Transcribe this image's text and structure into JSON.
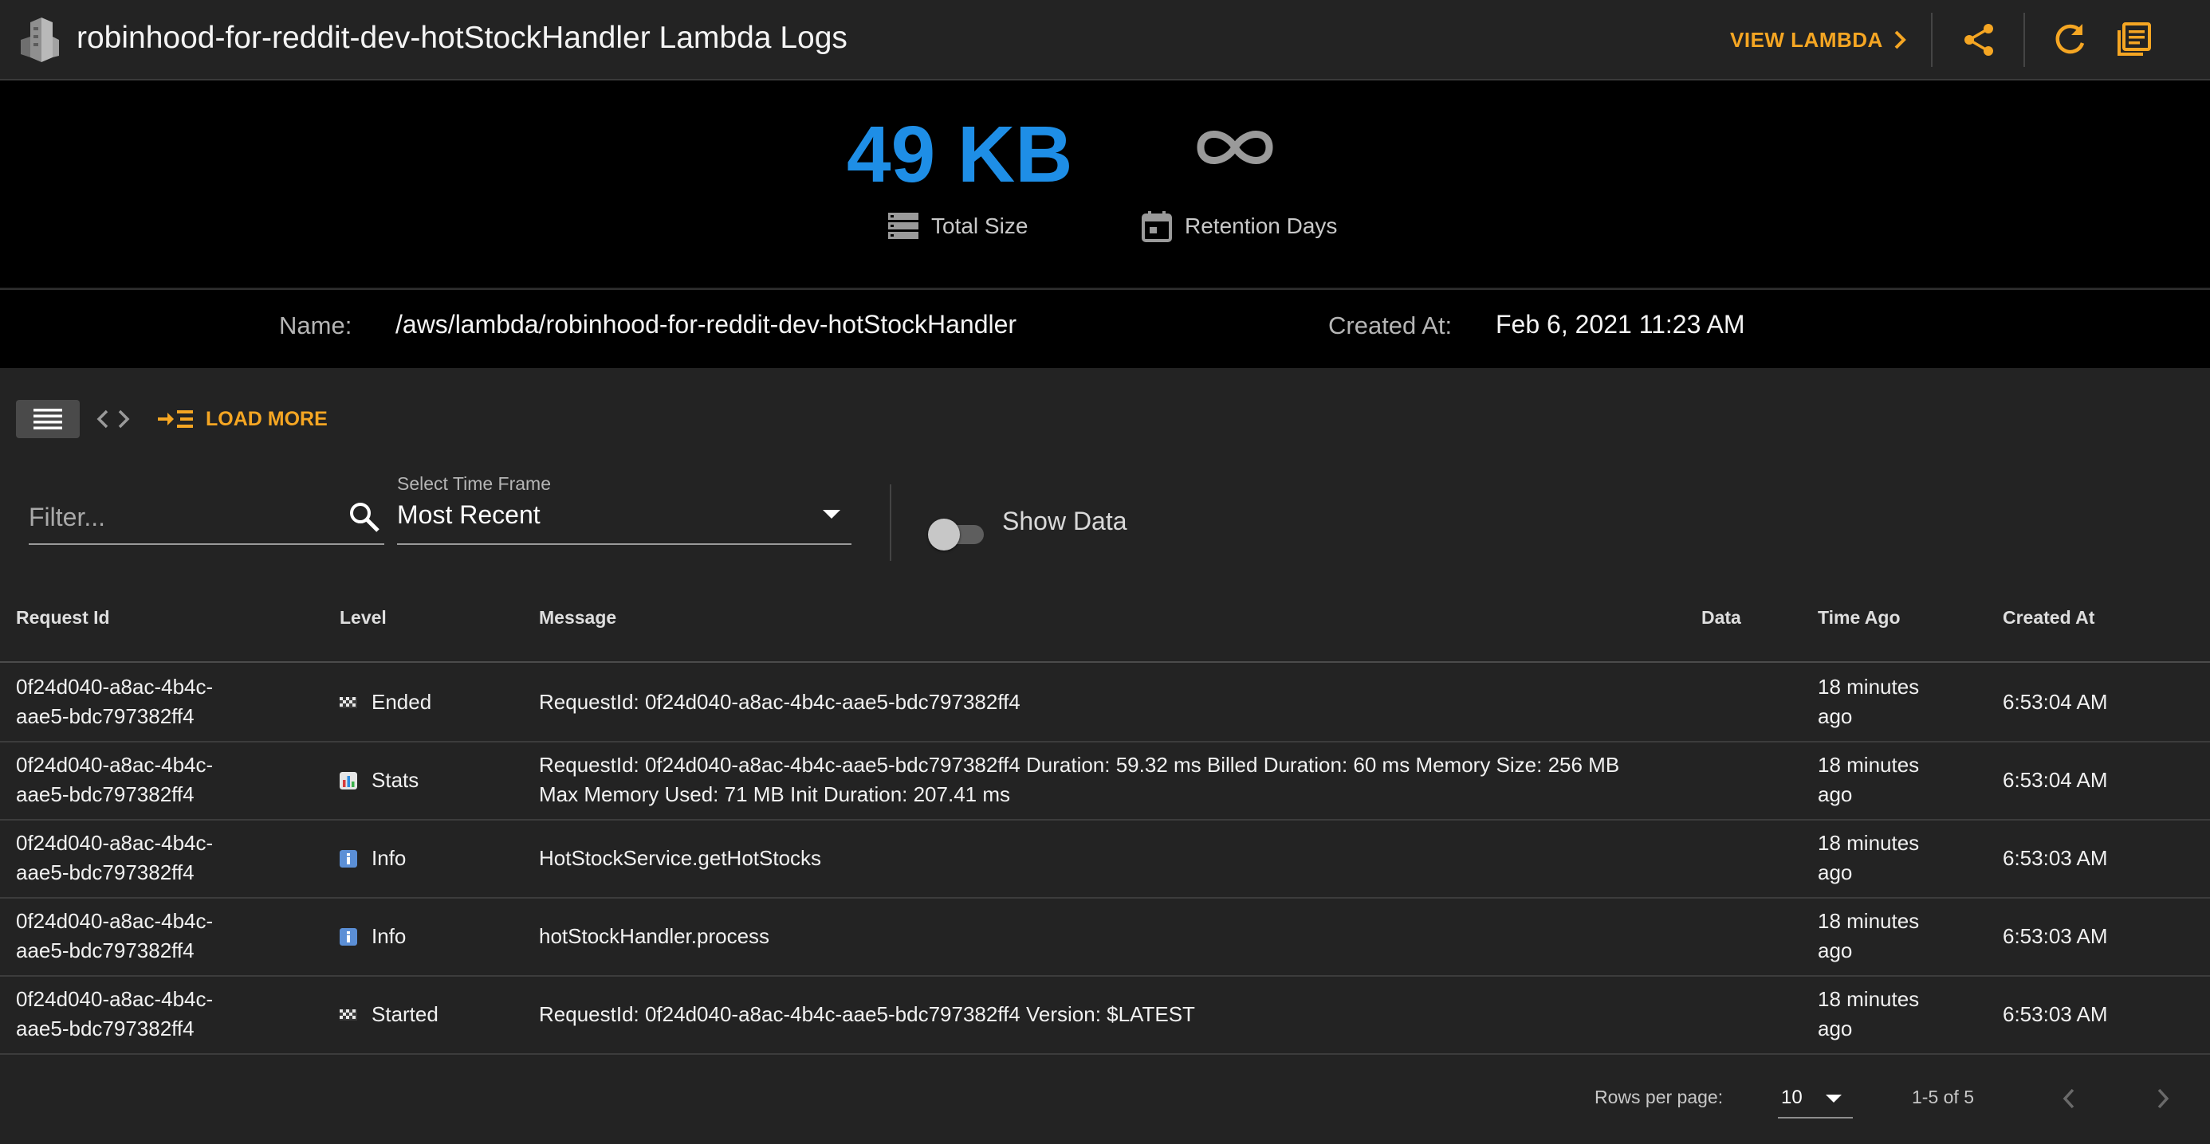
{
  "header": {
    "title": "robinhood-for-reddit-dev-hotStockHandler Lambda Logs",
    "view_lambda": "VIEW LAMBDA",
    "icons": [
      "building-logo-icon",
      "share-icon",
      "refresh-icon",
      "library-books-icon"
    ]
  },
  "stats": {
    "total_size_value": "49 KB",
    "total_size_label": "Total Size",
    "retention_value_icon": "infinity-icon",
    "retention_label": "Retention Days"
  },
  "details": {
    "name_label": "Name:",
    "name_value": "/aws/lambda/robinhood-for-reddit-dev-hotStockHandler",
    "created_label": "Created At:",
    "created_value": "Feb 6, 2021 11:23 AM"
  },
  "toolbar": {
    "load_more": "LOAD MORE",
    "filter_placeholder": "Filter...",
    "timeframe_label": "Select Time Frame",
    "timeframe_value": "Most Recent",
    "show_data_label": "Show Data",
    "show_data_on": false
  },
  "table": {
    "columns": [
      "Request Id",
      "Level",
      "Message",
      "Data",
      "Time Ago",
      "Created At"
    ],
    "rows": [
      {
        "request_id": "0f24d040-a8ac-4b4c-aae5-bdc797382ff4",
        "level": "Ended",
        "level_icon": "checkered-flag-icon",
        "message": "RequestId: 0f24d040-a8ac-4b4c-aae5-bdc797382ff4",
        "data": "",
        "time_ago": "18 minutes ago",
        "created_at": "6:53:04 AM"
      },
      {
        "request_id": "0f24d040-a8ac-4b4c-aae5-bdc797382ff4",
        "level": "Stats",
        "level_icon": "bar-chart-icon",
        "message": "RequestId: 0f24d040-a8ac-4b4c-aae5-bdc797382ff4 Duration: 59.32 ms Billed Duration: 60 ms Memory Size: 256 MB Max Memory Used: 71 MB Init Duration: 207.41 ms",
        "data": "",
        "time_ago": "18 minutes ago",
        "created_at": "6:53:04 AM"
      },
      {
        "request_id": "0f24d040-a8ac-4b4c-aae5-bdc797382ff4",
        "level": "Info",
        "level_icon": "info-icon",
        "message": "HotStockService.getHotStocks",
        "data": "",
        "time_ago": "18 minutes ago",
        "created_at": "6:53:03 AM"
      },
      {
        "request_id": "0f24d040-a8ac-4b4c-aae5-bdc797382ff4",
        "level": "Info",
        "level_icon": "info-icon",
        "message": "hotStockHandler.process",
        "data": "",
        "time_ago": "18 minutes ago",
        "created_at": "6:53:03 AM"
      },
      {
        "request_id": "0f24d040-a8ac-4b4c-aae5-bdc797382ff4",
        "level": "Started",
        "level_icon": "checkered-flag-icon",
        "message": "RequestId: 0f24d040-a8ac-4b4c-aae5-bdc797382ff4 Version: $LATEST",
        "data": "",
        "time_ago": "18 minutes ago",
        "created_at": "6:53:03 AM"
      }
    ]
  },
  "pagination": {
    "rows_per_page_label": "Rows per page:",
    "rows_per_page_value": "10",
    "range_text": "1-5 of 5"
  },
  "colors": {
    "accent": "#f5a623",
    "size_value": "#1e8ee6",
    "background": "#232323",
    "panel": "#000000"
  }
}
